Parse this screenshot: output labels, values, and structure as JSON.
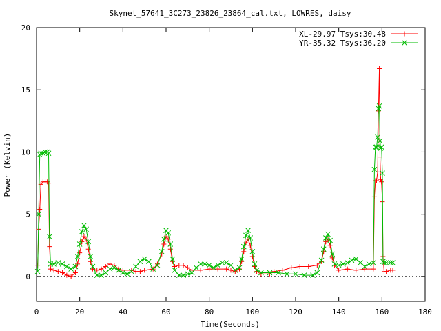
{
  "chart_data": {
    "type": "line",
    "title": "Skynet_57641_3C273_23826_23864_cal.txt, LOWRES, daisy",
    "xlabel": "Time(Seconds)",
    "ylabel": "Power (Kelvin)",
    "xlim": [
      0,
      180
    ],
    "ylim": [
      -2,
      20
    ],
    "xticks": [
      0,
      20,
      40,
      60,
      80,
      100,
      120,
      140,
      160,
      180
    ],
    "yticks": [
      0,
      5,
      10,
      15,
      20
    ],
    "grid": false,
    "legend_position": "top-right",
    "series": [
      {
        "name": "XL-29.97 Tsys:30.48",
        "color": "#ff0000",
        "marker": "plus",
        "points": [
          [
            0.5,
            0.9
          ],
          [
            1.0,
            3.8
          ],
          [
            1.5,
            5.4
          ],
          [
            2.0,
            7.4
          ],
          [
            3.0,
            7.6
          ],
          [
            4.0,
            7.6
          ],
          [
            5.0,
            7.6
          ],
          [
            5.6,
            7.5
          ],
          [
            6.0,
            2.4
          ],
          [
            6.5,
            0.6
          ],
          [
            8,
            0.5
          ],
          [
            10,
            0.4
          ],
          [
            12,
            0.3
          ],
          [
            14,
            0.1
          ],
          [
            16,
            0.0
          ],
          [
            18,
            0.3
          ],
          [
            19,
            1.0
          ],
          [
            20,
            1.9
          ],
          [
            21,
            2.8
          ],
          [
            22,
            3.2
          ],
          [
            23,
            3.0
          ],
          [
            24,
            2.2
          ],
          [
            25,
            1.2
          ],
          [
            26,
            0.6
          ],
          [
            28,
            0.5
          ],
          [
            30,
            0.6
          ],
          [
            32,
            0.8
          ],
          [
            34,
            1.0
          ],
          [
            36,
            0.9
          ],
          [
            38,
            0.6
          ],
          [
            40,
            0.5
          ],
          [
            44,
            0.5
          ],
          [
            46,
            0.4
          ],
          [
            48,
            0.4
          ],
          [
            50,
            0.5
          ],
          [
            54,
            0.6
          ],
          [
            56,
            1.0
          ],
          [
            58,
            1.8
          ],
          [
            59,
            2.6
          ],
          [
            60,
            3.2
          ],
          [
            61,
            3.0
          ],
          [
            62,
            2.2
          ],
          [
            63,
            1.2
          ],
          [
            64,
            0.8
          ],
          [
            66,
            0.9
          ],
          [
            68,
            0.9
          ],
          [
            70,
            0.7
          ],
          [
            72,
            0.5
          ],
          [
            76,
            0.5
          ],
          [
            80,
            0.6
          ],
          [
            84,
            0.6
          ],
          [
            88,
            0.6
          ],
          [
            90,
            0.5
          ],
          [
            92,
            0.4
          ],
          [
            94,
            0.6
          ],
          [
            95,
            1.2
          ],
          [
            96,
            2.0
          ],
          [
            97,
            2.7
          ],
          [
            98,
            3.0
          ],
          [
            99,
            2.5
          ],
          [
            100,
            1.6
          ],
          [
            101,
            0.8
          ],
          [
            102,
            0.4
          ],
          [
            104,
            0.2
          ],
          [
            108,
            0.2
          ],
          [
            110,
            0.4
          ],
          [
            114,
            0.5
          ],
          [
            118,
            0.7
          ],
          [
            122,
            0.8
          ],
          [
            126,
            0.8
          ],
          [
            130,
            0.9
          ],
          [
            132,
            1.2
          ],
          [
            133,
            2.0
          ],
          [
            134,
            2.8
          ],
          [
            135,
            3.0
          ],
          [
            136,
            2.5
          ],
          [
            137,
            1.5
          ],
          [
            138,
            0.9
          ],
          [
            140,
            0.5
          ],
          [
            144,
            0.6
          ],
          [
            148,
            0.5
          ],
          [
            152,
            0.6
          ],
          [
            156,
            0.6
          ],
          [
            156.5,
            6.4
          ],
          [
            157,
            7.7
          ],
          [
            157.5,
            7.7
          ],
          [
            158,
            8.4
          ],
          [
            158.4,
            13.3
          ],
          [
            158.8,
            16.7
          ],
          [
            159.1,
            9.6
          ],
          [
            159.4,
            7.8
          ],
          [
            159.8,
            7.6
          ],
          [
            160.2,
            6.0
          ],
          [
            160.5,
            1.6
          ],
          [
            161,
            0.4
          ],
          [
            162,
            0.4
          ],
          [
            164,
            0.5
          ],
          [
            165,
            0.5
          ]
        ]
      },
      {
        "name": "YR-35.32 Tsys:36.20",
        "color": "#00bb00",
        "marker": "x",
        "points": [
          [
            0.5,
            0.4
          ],
          [
            1.0,
            5.0
          ],
          [
            1.5,
            9.8
          ],
          [
            2.0,
            9.9
          ],
          [
            3.0,
            9.9
          ],
          [
            4.0,
            10.0
          ],
          [
            5.0,
            10.0
          ],
          [
            5.6,
            9.9
          ],
          [
            6.0,
            3.2
          ],
          [
            6.5,
            1.0
          ],
          [
            8,
            1.0
          ],
          [
            10,
            1.1
          ],
          [
            12,
            1.0
          ],
          [
            14,
            0.8
          ],
          [
            16,
            0.6
          ],
          [
            18,
            0.8
          ],
          [
            19,
            1.6
          ],
          [
            20,
            2.6
          ],
          [
            21,
            3.6
          ],
          [
            22,
            4.1
          ],
          [
            23,
            3.8
          ],
          [
            24,
            2.8
          ],
          [
            25,
            1.6
          ],
          [
            26,
            0.8
          ],
          [
            28,
            0.1
          ],
          [
            30,
            0.1
          ],
          [
            32,
            0.3
          ],
          [
            34,
            0.6
          ],
          [
            36,
            0.7
          ],
          [
            38,
            0.5
          ],
          [
            40,
            0.3
          ],
          [
            42,
            0.2
          ],
          [
            44,
            0.4
          ],
          [
            46,
            0.8
          ],
          [
            48,
            1.2
          ],
          [
            50,
            1.4
          ],
          [
            52,
            1.2
          ],
          [
            54,
            0.6
          ],
          [
            56,
            0.9
          ],
          [
            58,
            2.0
          ],
          [
            59,
            3.0
          ],
          [
            60,
            3.7
          ],
          [
            61,
            3.5
          ],
          [
            62,
            2.6
          ],
          [
            63,
            1.4
          ],
          [
            64,
            0.5
          ],
          [
            66,
            0.1
          ],
          [
            68,
            0.1
          ],
          [
            70,
            0.2
          ],
          [
            72,
            0.3
          ],
          [
            74,
            0.7
          ],
          [
            76,
            1.0
          ],
          [
            78,
            1.0
          ],
          [
            80,
            0.9
          ],
          [
            82,
            0.7
          ],
          [
            84,
            0.9
          ],
          [
            86,
            1.1
          ],
          [
            88,
            1.1
          ],
          [
            90,
            0.9
          ],
          [
            92,
            0.5
          ],
          [
            94,
            0.7
          ],
          [
            95,
            1.4
          ],
          [
            96,
            2.4
          ],
          [
            97,
            3.3
          ],
          [
            98,
            3.7
          ],
          [
            99,
            3.1
          ],
          [
            100,
            2.0
          ],
          [
            101,
            1.0
          ],
          [
            102,
            0.5
          ],
          [
            104,
            0.3
          ],
          [
            108,
            0.3
          ],
          [
            112,
            0.3
          ],
          [
            116,
            0.2
          ],
          [
            120,
            0.2
          ],
          [
            124,
            0.1
          ],
          [
            128,
            0.1
          ],
          [
            130,
            0.3
          ],
          [
            132,
            1.3
          ],
          [
            133,
            2.2
          ],
          [
            134,
            3.1
          ],
          [
            135,
            3.4
          ],
          [
            136,
            2.9
          ],
          [
            137,
            1.8
          ],
          [
            138,
            1.0
          ],
          [
            140,
            0.9
          ],
          [
            142,
            1.0
          ],
          [
            144,
            1.1
          ],
          [
            146,
            1.3
          ],
          [
            148,
            1.4
          ],
          [
            150,
            1.1
          ],
          [
            152,
            0.8
          ],
          [
            154,
            1.0
          ],
          [
            156,
            1.1
          ],
          [
            156.5,
            8.6
          ],
          [
            157,
            10.4
          ],
          [
            157.5,
            10.4
          ],
          [
            158,
            11.2
          ],
          [
            158.4,
            13.5
          ],
          [
            158.8,
            13.7
          ],
          [
            159.1,
            10.9
          ],
          [
            159.4,
            10.3
          ],
          [
            159.8,
            10.4
          ],
          [
            160.2,
            8.3
          ],
          [
            160.5,
            1.2
          ],
          [
            161,
            1.1
          ],
          [
            162,
            1.1
          ],
          [
            164,
            1.1
          ],
          [
            165,
            1.1
          ]
        ]
      }
    ]
  }
}
